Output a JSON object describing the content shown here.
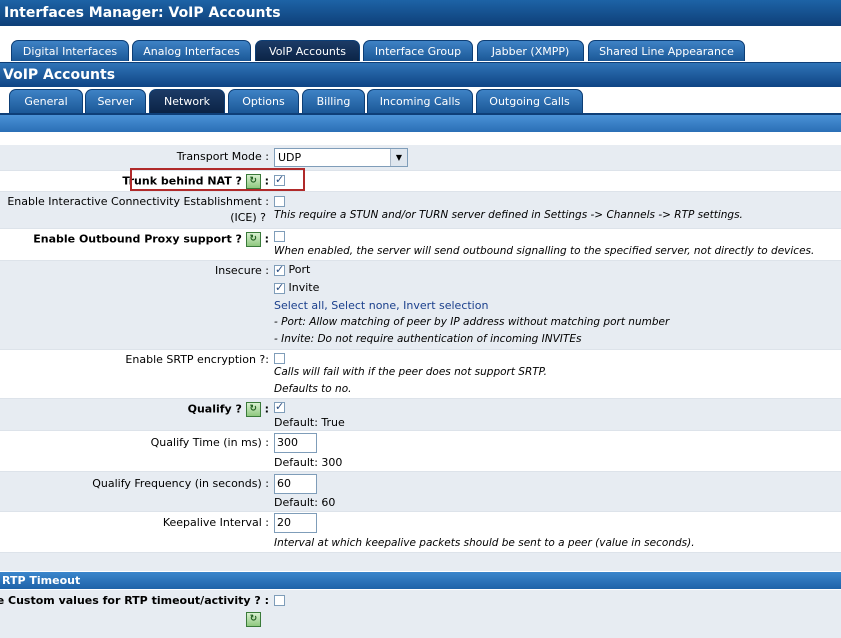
{
  "window_title": "Interfaces Manager:  VoIP Accounts",
  "top_tabs": [
    {
      "label": "Digital Interfaces",
      "active": false
    },
    {
      "label": "Analog Interfaces",
      "active": false
    },
    {
      "label": "VoIP Accounts",
      "active": true
    },
    {
      "label": "Interface Group",
      "active": false
    },
    {
      "label": "Jabber (XMPP)",
      "active": false
    },
    {
      "label": "Shared Line Appearance",
      "active": false
    }
  ],
  "section_title": "VoIP Accounts",
  "sub_tabs": [
    {
      "label": "General",
      "active": false
    },
    {
      "label": "Server",
      "active": false
    },
    {
      "label": "Network",
      "active": true
    },
    {
      "label": "Options",
      "active": false
    },
    {
      "label": "Billing",
      "active": false
    },
    {
      "label": "Incoming Calls",
      "active": false
    },
    {
      "label": "Outgoing Calls",
      "active": false
    }
  ],
  "form": {
    "transport_mode": {
      "label": "Transport Mode",
      "colon": ":",
      "value": "UDP"
    },
    "trunk_nat": {
      "label": "Trunk behind NAT ?",
      "colon": ":",
      "checked": true
    },
    "ice": {
      "label_line1": "Enable Interactive Connectivity Establishment",
      "colon": ":",
      "label_line2": "(ICE) ?",
      "checked": false,
      "note": "This require a STUN and/or TURN server defined in Settings -> Channels -> RTP settings."
    },
    "outbound_proxy": {
      "label": "Enable Outbound Proxy support ?",
      "colon": ":",
      "checked": false,
      "note": "When enabled, the server will send outbound signalling to the specified server, not directly to devices."
    },
    "insecure": {
      "label": "Insecure",
      "colon": ":",
      "options": [
        {
          "label": "Port",
          "checked": true
        },
        {
          "label": "Invite",
          "checked": true
        }
      ],
      "select_all": "Select all",
      "sep1": ",",
      "select_none": "Select none",
      "sep2": ",",
      "invert": "Invert selection",
      "note1": "- Port: Allow matching of peer by IP address without matching port number",
      "note2": "- Invite: Do not require authentication of incoming INVITEs"
    },
    "srtp": {
      "label": "Enable SRTP encryption ?",
      "colon": ":",
      "checked": false,
      "note1": "Calls will fail with if the peer does not support SRTP.",
      "note2": "Defaults to no."
    },
    "qualify": {
      "label": "Qualify ?",
      "colon": ":",
      "checked": true,
      "default": "Default: True"
    },
    "qualify_time": {
      "label": "Qualify Time (in ms)",
      "colon": ":",
      "value": "300",
      "default": "Default: 300"
    },
    "qualify_freq": {
      "label": "Qualify Frequency (in seconds)",
      "colon": ":",
      "value": "60",
      "default": "Default: 60"
    },
    "keepalive": {
      "label": "Keepalive Interval",
      "colon": ":",
      "value": "20",
      "note": "Interval at which keepalive packets should be sent to a peer (value in seconds)."
    }
  },
  "rtp_section": {
    "title": "RTP Timeout",
    "custom": {
      "label": "Use Custom values for RTP timeout/activity ?",
      "colon": ":",
      "checked": false
    }
  },
  "help_icon_glyph": "↻"
}
